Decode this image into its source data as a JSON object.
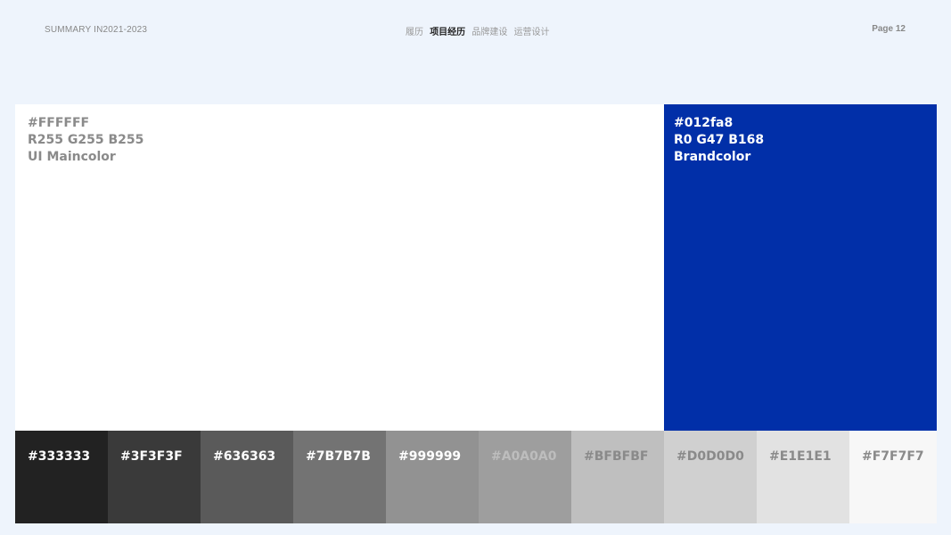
{
  "header": {
    "summary": "SUMMARY IN2021-2023",
    "nav": [
      {
        "label": "履历",
        "active": false
      },
      {
        "label": "项目经历",
        "active": true
      },
      {
        "label": "品牌建设",
        "active": false
      },
      {
        "label": "运营设计",
        "active": false
      }
    ],
    "page": "Page 12"
  },
  "main_colors": {
    "white": {
      "hex": "#FFFFFF",
      "hex_label": "#FFFFFF",
      "rgb_label": "R255 G255 B255",
      "name": "UI Maincolor"
    },
    "brand": {
      "hex": "#012fa8",
      "hex_label": "#012fa8",
      "rgb_label": "R0 G47 B168",
      "name": "Brandcolor"
    }
  },
  "grays": [
    {
      "label": "#333333",
      "fill": "#222222",
      "text_color": "#ffffff"
    },
    {
      "label": "#3F3F3F",
      "fill": "#3a3a3a",
      "text_color": "#ffffff"
    },
    {
      "label": "#636363",
      "fill": "#5a5a5a",
      "text_color": "#ffffff"
    },
    {
      "label": "#7B7B7B",
      "fill": "#737373",
      "text_color": "#ffffff"
    },
    {
      "label": "#999999",
      "fill": "#929292",
      "text_color": "#ffffff"
    },
    {
      "label": "#A0A0A0",
      "fill": "#9e9e9e",
      "text_color": "#bdbdbd"
    },
    {
      "label": "#BFBFBF",
      "fill": "#bfbfbf",
      "text_color": "#8a8a8a"
    },
    {
      "label": "#D0D0D0",
      "fill": "#d0d0d0",
      "text_color": "#8a8a8a"
    },
    {
      "label": "#E1E1E1",
      "fill": "#e2e2e2",
      "text_color": "#8a8a8a"
    },
    {
      "label": "#F7F7F7",
      "fill": "#f7f7f7",
      "text_color": "#8a8a8a"
    }
  ]
}
